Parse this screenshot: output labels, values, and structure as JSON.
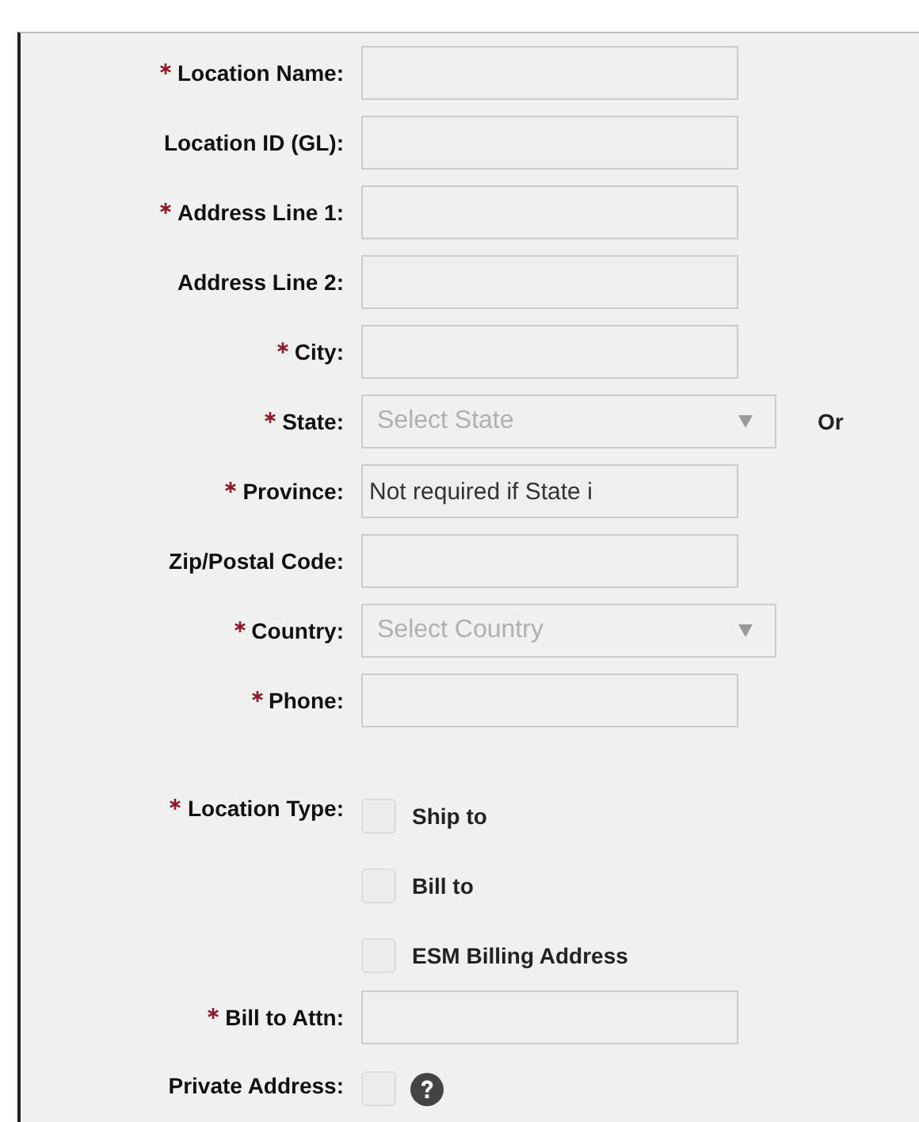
{
  "fields": [
    {
      "kind": "text",
      "label": "Location Name:",
      "required": true
    },
    {
      "kind": "text",
      "label": "Location ID (GL):",
      "required": false
    },
    {
      "kind": "text",
      "label": "Address Line 1:",
      "required": true
    },
    {
      "kind": "text",
      "label": "Address Line 2:",
      "required": false
    },
    {
      "kind": "text",
      "label": "City:",
      "required": true
    },
    {
      "kind": "select",
      "label": "State:",
      "required": true,
      "placeholder": "Select State",
      "note": "Or"
    },
    {
      "kind": "text",
      "label": "Province:",
      "required": true,
      "value": "Not required if State i"
    },
    {
      "kind": "text",
      "label": "Zip/Postal Code:",
      "required": false
    },
    {
      "kind": "select",
      "label": "Country:",
      "required": true,
      "placeholder": "Select Country"
    },
    {
      "kind": "text",
      "label": "Phone:",
      "required": true
    },
    {
      "kind": "checks",
      "label": "Location Type:",
      "required": true,
      "options": [
        {
          "label": "Ship to",
          "checked": false
        },
        {
          "label": "Bill to",
          "checked": false
        },
        {
          "label": "ESM Billing Address",
          "checked": false
        }
      ]
    },
    {
      "kind": "text",
      "label": "Bill to Attn:",
      "required": true
    },
    {
      "kind": "check",
      "label": "Private Address:",
      "required": false,
      "checked": false,
      "help": true
    }
  ]
}
